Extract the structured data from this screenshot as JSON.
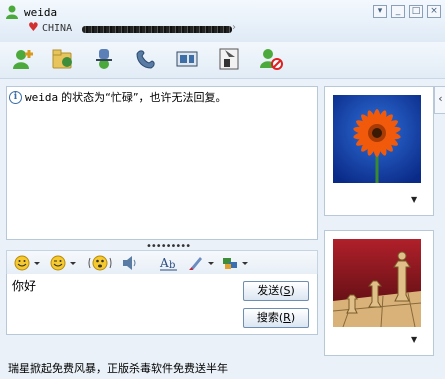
{
  "titlebar": {
    "contact_name": "weida",
    "status_country": "CHINA"
  },
  "chat": {
    "system_sender": "weida",
    "system_message": " 的状态为“忙碌”，也许无法回复。"
  },
  "input": {
    "text": "你好"
  },
  "buttons": {
    "send_label": "发送",
    "send_key": "S",
    "search_label": "搜索",
    "search_key": "R"
  },
  "footer": {
    "ad_text": "瑞星掀起免费风暴，正版杀毒软件免费送半年"
  },
  "icons": {
    "toolbar": [
      "add-contact-icon",
      "file-transfer-icon",
      "voice-chat-icon",
      "phone-call-icon",
      "video-icon",
      "remote-assist-icon",
      "block-icon"
    ],
    "input_toolbar": [
      "emoticon-icon",
      "wink-icon",
      "nudge-icon",
      "voice-clip-icon",
      "font-icon",
      "background-icon",
      "games-icon"
    ]
  },
  "colors": {
    "accent": "#3a6ea8",
    "status_heart": "#d23030"
  }
}
